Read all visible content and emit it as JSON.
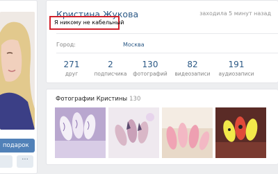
{
  "left_panel": {
    "gift_button_label": "подарок",
    "more_button_label": "···"
  },
  "profile": {
    "name": "Кристина Жукова",
    "last_seen": "заходила 5 минут назад",
    "status": "Я никому не кабельный",
    "city_label": "Город:",
    "city_value": "Москва"
  },
  "counters": [
    {
      "value": "271",
      "label": "друг"
    },
    {
      "value": "2",
      "label": "подписчика"
    },
    {
      "value": "130",
      "label": "фотографий"
    },
    {
      "value": "82",
      "label": "видеозаписи"
    },
    {
      "value": "191",
      "label": "аудиозаписи"
    }
  ],
  "photos": {
    "title": "Фотографии Кристины",
    "count": "130"
  },
  "colors": {
    "link": "#2a5885",
    "button": "#5181b8",
    "status_highlight": "#d1212c",
    "background": "#edeef0"
  }
}
